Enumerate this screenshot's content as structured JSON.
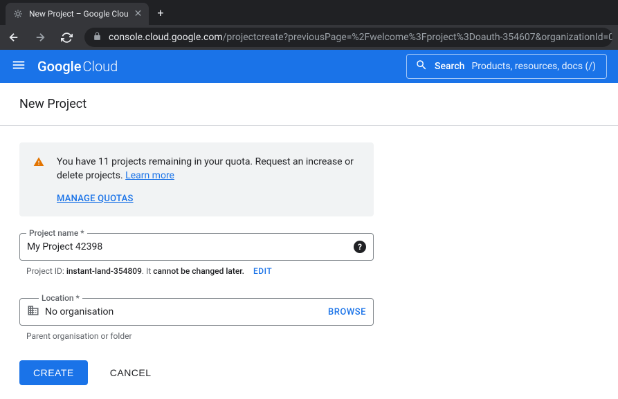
{
  "browser": {
    "tab_title": "New Project – Google Clou",
    "url_domain": "console.cloud.google.com",
    "url_path": "/projectcreate?previousPage=%2Fwelcome%3Fproject%3Doauth-354607&organizationId=0"
  },
  "header": {
    "logo_bold": "Google",
    "logo_light": " Cloud",
    "search_label": "Search",
    "search_placeholder": "Products, resources, docs (/)"
  },
  "page": {
    "title": "New Project",
    "quota": {
      "text_before": "You have 11 projects remaining in your quota. Request an increase or delete projects. ",
      "learn_more": "Learn more",
      "manage": "MANAGE QUOTAS"
    },
    "project_name": {
      "label": "Project name *",
      "value": "My Project 42398",
      "hint_prefix": "Project ID: ",
      "hint_id": "instant-land-354809",
      "hint_mid": ". It ",
      "hint_warn": "cannot be changed later.",
      "edit": "EDIT"
    },
    "location": {
      "label": "Location *",
      "value": "No organisation",
      "browse": "BROWSE",
      "hint": "Parent organisation or folder"
    },
    "actions": {
      "create": "CREATE",
      "cancel": "CANCEL"
    }
  }
}
